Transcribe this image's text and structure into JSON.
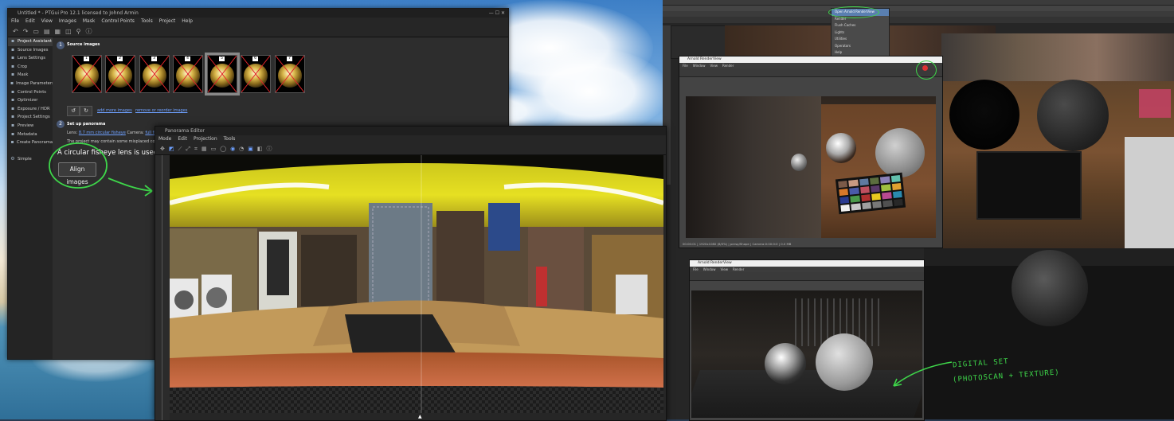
{
  "ptgui": {
    "title": "Untitled * - PTGui Pro 12.1 licensed to Johnd Armin",
    "menu": [
      "File",
      "Edit",
      "View",
      "Images",
      "Mask",
      "Control Points",
      "Tools",
      "Project",
      "Help"
    ],
    "sidebar": [
      {
        "label": "Project Assistant",
        "icon": "assistant-icon"
      },
      {
        "label": "Source Images",
        "icon": "images-icon"
      },
      {
        "label": "Lens Settings",
        "icon": "lens-icon"
      },
      {
        "label": "Crop",
        "icon": "crop-icon"
      },
      {
        "label": "Mask",
        "icon": "mask-icon"
      },
      {
        "label": "Image Parameters",
        "icon": "parameters-icon"
      },
      {
        "label": "Control Points",
        "icon": "points-icon"
      },
      {
        "label": "Optimizer",
        "icon": "optimizer-icon"
      },
      {
        "label": "Exposure / HDR",
        "icon": "exposure-icon"
      },
      {
        "label": "Project Settings",
        "icon": "settings-icon"
      },
      {
        "label": "Preview",
        "icon": "preview-icon"
      },
      {
        "label": "Metadata",
        "icon": "metadata-icon"
      },
      {
        "label": "Create Panorama",
        "icon": "create-icon"
      }
    ],
    "simple_label": "Simple",
    "step1": {
      "num": "1",
      "title": "Source images"
    },
    "thumbs": [
      "1",
      "2",
      "3",
      "4",
      "5",
      "6",
      "7"
    ],
    "add_more": "add more images",
    "remove_reorder": "remove or reorder images",
    "step2": {
      "num": "2",
      "title": "Set up panorama"
    },
    "lens_label": "Lens:",
    "lens_value": "8.7 mm circular fisheye",
    "camera_label": "Camera:",
    "camera_value": "full frame",
    "warning": "The project may contain some misplaced control p",
    "fisheye_note": "A circular fisheye lens is used. Make s",
    "align_button": "Align images"
  },
  "pano_editor": {
    "title": "Panorama Editor",
    "menu": [
      "Mode",
      "Edit",
      "Projection",
      "Tools"
    ]
  },
  "maya": {
    "render_view_title": "Arnold RenderView",
    "render_view_menu": [
      "File",
      "Window",
      "View",
      "Render"
    ],
    "status_text": "00:00:01 | 1920x1080 (8/0%) | persp/Shape | Camera:0:00:0:0 | 0.0 MB",
    "render_view2_title": "Arnold RenderView",
    "render_view2_menu": [
      "File",
      "Window",
      "View",
      "Render"
    ],
    "arnold_menu": [
      "Open Arnold RenderView",
      "Render",
      "Flush Caches",
      "Lights",
      "Utilities",
      "Operators",
      "Help",
      "About"
    ],
    "workspace_value": "Maya Classic"
  },
  "annotation": {
    "line1": "DIGITAL SET",
    "line2": "(PHOTOSCAN + TEXTURE)"
  },
  "colors": {
    "accent_green": "#3ed64a",
    "link_blue": "#6ea0ff",
    "red_cross": "#e0242a"
  }
}
